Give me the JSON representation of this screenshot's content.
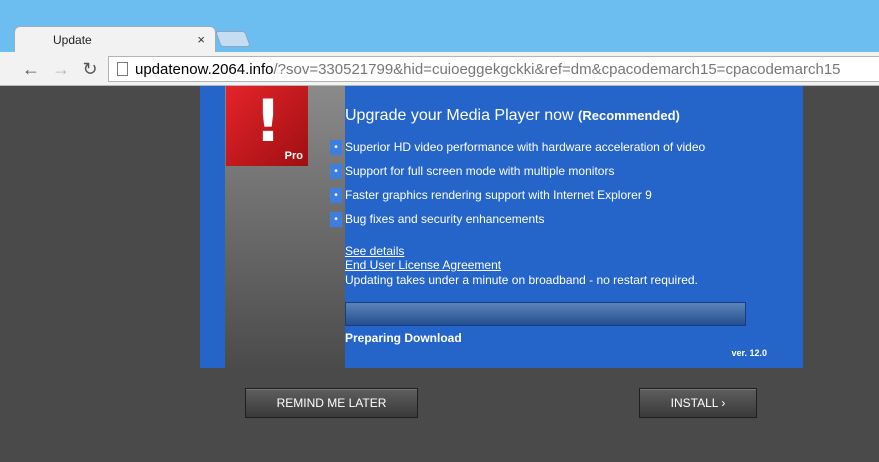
{
  "browser": {
    "tab_title": "Update",
    "tab_close": "×",
    "url_host": "updatenow.2064.info",
    "url_path": "/?sov=330521799&hid=cuioeggekgckki&ref=dm&cpacodemarch15=cpacodemarch15",
    "nav": {
      "back": "←",
      "forward": "→",
      "reload": "↻"
    }
  },
  "logo": {
    "mark": "!",
    "badge": "Pro"
  },
  "dialog": {
    "headline": "Upgrade your Media Player now",
    "headline_sub": "(Recommended)",
    "bullet_glyph": "•",
    "features": [
      "Superior HD video performance with hardware acceleration of video",
      "Support for full screen mode with multiple monitors",
      "Faster graphics rendering support with Internet Explorer 9",
      "Bug fixes and security enhancements"
    ],
    "see_details": "See details",
    "eula": "End User License Agreement",
    "note": "Updating takes under a minute on broadband - no restart required.",
    "status": "Preparing Download",
    "progress_percent": 0,
    "version": "ver.  12.0"
  },
  "buttons": {
    "remind": "REMIND ME LATER",
    "install": "INSTALL ›"
  },
  "colors": {
    "panel": "#2565c9",
    "logo": "#d51f24",
    "page_bg": "#4a4a4a",
    "chrome": "#6cbef0"
  }
}
